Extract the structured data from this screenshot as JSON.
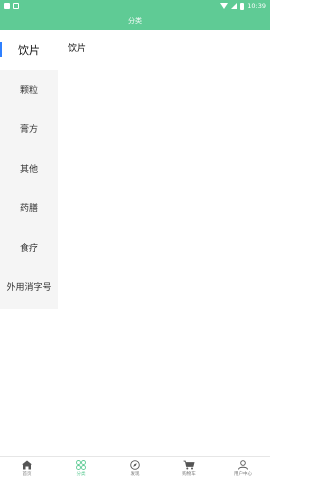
{
  "status_bar": {
    "time": "10:39",
    "left_icons": [
      "image-icon",
      "notification-icon"
    ],
    "right_icons": [
      "wifi-icon",
      "signal-icon",
      "battery-icon"
    ]
  },
  "header": {
    "title": "分类"
  },
  "sidebar": {
    "items": [
      {
        "label": "饮片",
        "active": true
      },
      {
        "label": "颗粒",
        "active": false
      },
      {
        "label": "膏方",
        "active": false
      },
      {
        "label": "其他",
        "active": false
      },
      {
        "label": "药膳",
        "active": false
      },
      {
        "label": "食疗",
        "active": false
      },
      {
        "label": "外用消字号",
        "active": false
      }
    ]
  },
  "main": {
    "section_title": "饮片"
  },
  "bottom_nav": {
    "items": [
      {
        "label": "首页",
        "icon": "home-icon",
        "active": false
      },
      {
        "label": "分类",
        "icon": "category-icon",
        "active": true
      },
      {
        "label": "发现",
        "icon": "compass-icon",
        "active": false
      },
      {
        "label": "购物车",
        "icon": "cart-icon",
        "active": false
      },
      {
        "label": "用户中心",
        "icon": "user-icon",
        "active": false
      }
    ]
  },
  "colors": {
    "brand": "#5fcb95",
    "active_indicator": "#2f80ff",
    "sidebar_bg": "#f5f5f5"
  }
}
